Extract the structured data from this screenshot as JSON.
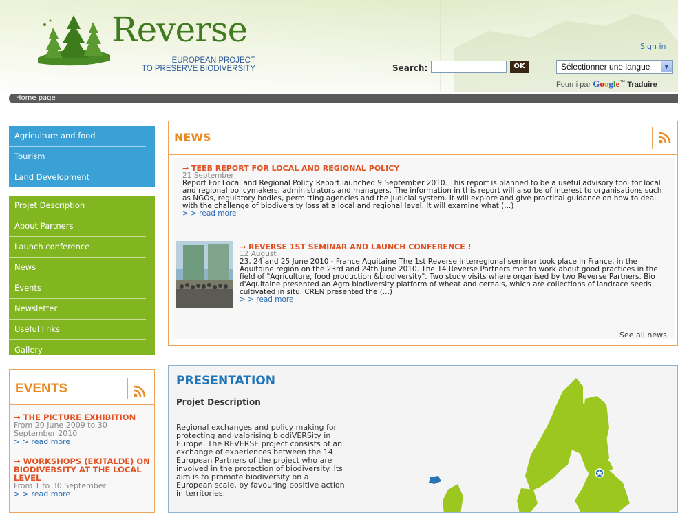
{
  "header": {
    "logo_word": "Reverse",
    "logo_sub_line1": "EUROPEAN PROJECT",
    "logo_sub_line2": "TO PRESERVE BIODIVERSITY",
    "signin": "Sign in",
    "search_label": "Search:",
    "search_value": "",
    "search_button": "OK",
    "language_select": "Sélectionner une langue",
    "powered_prefix": "Fourni par",
    "powered_google": "Google",
    "powered_tm": "™",
    "powered_traduire": "Traduire"
  },
  "breadcrumb": "Home page",
  "menu_blue": [
    "Agriculture and food",
    "Tourism",
    "Land Development"
  ],
  "menu_green": [
    "Projet Description",
    "About Partners",
    "Launch conference",
    "News",
    "Events",
    "Newsletter",
    "Useful links",
    "Gallery"
  ],
  "events": {
    "title": "EVENTS",
    "items": [
      {
        "title": "→ THE PICTURE EXHIBITION",
        "date": "From 20 June 2009 to 30 September 2010",
        "more": "> > read more"
      },
      {
        "title": "→ WORKSHOPS (EKITALDE) ON BIODIVERSITY AT THE LOCAL LEVEL",
        "date": "From 1 to 30 September",
        "more": "> > read more"
      }
    ]
  },
  "news": {
    "title": "NEWS",
    "items": [
      {
        "title": "→ TEEB REPORT FOR LOCAL AND REGIONAL POLICY",
        "date": "21 September",
        "text": "Report For Local and Regional Policy Report launched 9 September 2010. This report is planned to be a useful advisory tool for local and regional policymakers, administrators and managers. The information in this report will also be of interest to organisations such as NGOs, regulatory bodies, permitting agencies and the judicial system. It will explore and give practical guidance on how to deal with the challenge of biodiversity loss at a local and regional level. It will examine what (...)",
        "more": "> > read more"
      },
      {
        "title": "→ REVERSE 1ST SEMINAR AND LAUNCH CONFERENCE !",
        "date": "12 August",
        "text": "23, 24 and 25 June 2010 - France Aquitaine The 1st Reverse interregional seminar took place in France, in the Aquitaine region on the 23rd and 24th June 2010. The 14 Reverse Partners met to work about good practices in the field of \"Agriculture, food production &biodiversity\". Two study visits where organised by two Reverse Partners. Bio d'Aquitaine presented an Agro biodiversity platform of wheat and cereals, which are collections of landrace seeds cultivated in situ. CREN presented the (...)",
        "more": "> > read more"
      }
    ],
    "see_all": "See all news"
  },
  "presentation": {
    "title": "PRESENTATION",
    "subtitle": "Projet Description",
    "text": "Regional exchanges and policy making for protecting and valorising biodiVERSity in Europe. The REVERSE project consists of an exchange of experiences between the 14 European Partners of the project who are involved in the protection of biodiversity. Its aim is to promote biodiversity on a European scale, by favouring positive action in territories."
  },
  "colors": {
    "orange": "#e88a1f",
    "blue_menu": "#3aa1d6",
    "green_menu": "#82b620",
    "link": "#2b6db2",
    "title_red": "#e05020"
  }
}
